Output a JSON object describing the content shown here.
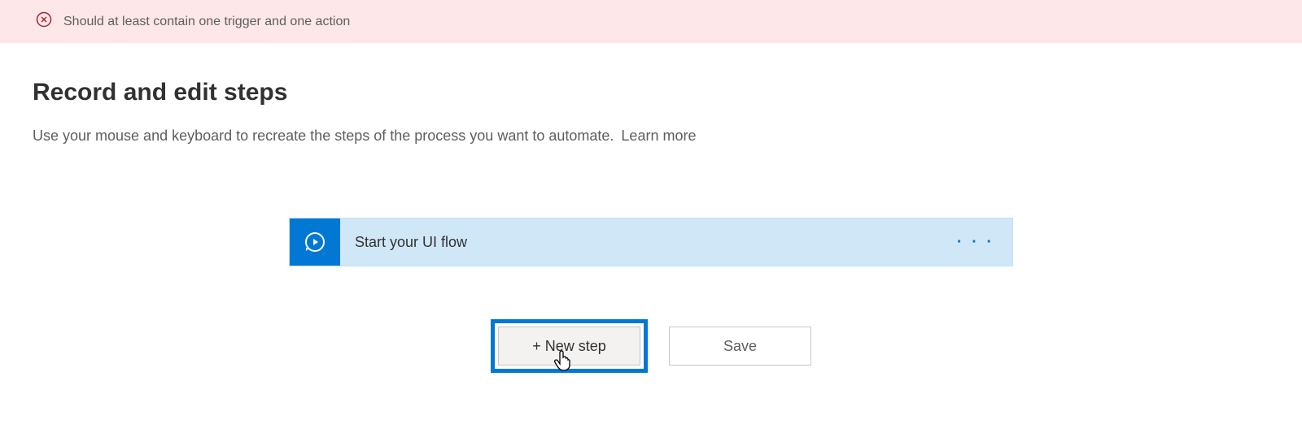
{
  "error": {
    "message": "Should at least contain one trigger and one action"
  },
  "header": {
    "title": "Record and edit steps",
    "description": "Use your mouse and keyboard to recreate the steps of the process you want to automate.",
    "learn_more": "Learn more"
  },
  "step": {
    "title": "Start your UI flow"
  },
  "buttons": {
    "new_step": "+ New step",
    "save": "Save"
  }
}
